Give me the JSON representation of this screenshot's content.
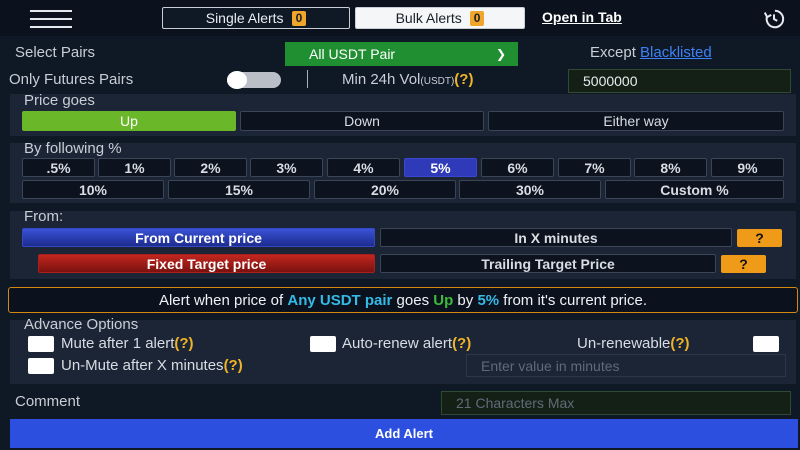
{
  "tabs": {
    "single_label": "Single Alerts",
    "single_count": "0",
    "bulk_label": "Bulk Alerts",
    "bulk_count": "0",
    "open_in_tab": "Open in Tab"
  },
  "pairs": {
    "label": "Select Pairs",
    "selected": "All USDT Pair",
    "except_label": "Except",
    "blacklisted_link": "Blacklisted",
    "futures_label": "Only Futures Pairs",
    "futures_on": false,
    "min_vol_label": "Min 24h Vol",
    "min_vol_unit": "(USDT)",
    "help": "(?)",
    "min_vol_value": "5000000"
  },
  "price_goes": {
    "label": "Price goes",
    "options": [
      "Up",
      "Down",
      "Either way"
    ],
    "selected": "Up"
  },
  "percent": {
    "label": "By following %",
    "row1": [
      ".5%",
      "1%",
      "2%",
      "3%",
      "4%",
      "5%",
      "6%",
      "7%",
      "8%",
      "9%"
    ],
    "row2": [
      "10%",
      "15%",
      "20%",
      "30%",
      "Custom %"
    ],
    "selected": "5%"
  },
  "from": {
    "label": "From:",
    "current": "From Current price",
    "x_minutes": "In X minutes",
    "fixed": "Fixed Target price",
    "trailing": "Trailing Target Price",
    "help_btn": "?"
  },
  "summary": {
    "p1": "Alert when price of ",
    "pair": "Any USDT pair",
    "p2": " goes ",
    "dir": "Up",
    "p3": " by ",
    "pct": "5%",
    "p4": " from it's current price."
  },
  "advance": {
    "label": "Advance Options",
    "mute": "Mute after 1 alert",
    "auto_renew": "Auto-renew alert",
    "unrenewable": "Un-renewable",
    "unmute": "Un-Mute after X minutes",
    "help": "(?)",
    "minutes_placeholder": "Enter value in minutes"
  },
  "comment": {
    "label": "Comment",
    "placeholder": "21 Characters Max"
  },
  "add_button": "Add Alert",
  "colors": {
    "background": "#0f1825",
    "panel": "#1b2535",
    "accent_green": "#6ab82a",
    "accent_blue": "#2d4fe0",
    "warning_orange": "#f09a1a"
  }
}
